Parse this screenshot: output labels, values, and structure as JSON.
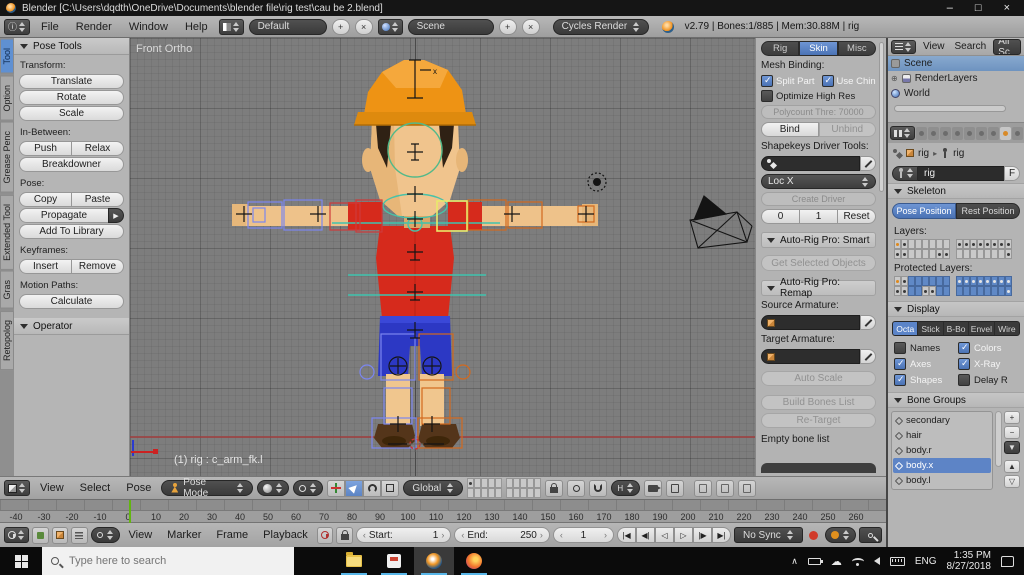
{
  "title_bar": {
    "title": "Blender [C:\\Users\\dqdth\\OneDrive\\Documents\\blender file\\rig test\\cau be 2.blend]"
  },
  "icons": {
    "minimize": "–",
    "maximize": "□",
    "close": "×",
    "add": "+",
    "x_small": "×",
    "propagate_arrow": "▶",
    "expand": "⊕",
    "playback": {
      "jump_start": "|◀",
      "prev_key": "◀|",
      "play_rev": "◁",
      "play": "▷",
      "next_key": "|▶",
      "jump_end": "▶|"
    }
  },
  "info_bar": {
    "menu_file": "File",
    "menu_render": "Render",
    "menu_window": "Window",
    "menu_help": "Help",
    "layout": "Default",
    "scene": "Scene",
    "engine": "Cycles Render",
    "stats": "v2.79 | Bones:1/885 | Mem:30.88M | rig"
  },
  "tool_shelf": {
    "tabs": [
      {
        "label": "Tool"
      },
      {
        "label": "Option"
      },
      {
        "label": "Grease Penc"
      },
      {
        "label": "Extended Tool"
      },
      {
        "label": "Gras"
      },
      {
        "label": "Retopolog"
      }
    ],
    "pose_tools_title": "Pose Tools",
    "transform_label": "Transform:",
    "translate": "Translate",
    "rotate": "Rotate",
    "scale": "Scale",
    "in_between_label": "In-Between:",
    "push": "Push",
    "relax": "Relax",
    "breakdowner": "Breakdowner",
    "pose_label": "Pose:",
    "copy": "Copy",
    "paste": "Paste",
    "propagate": "Propagate",
    "add_to_library": "Add To Library",
    "keyframes_label": "Keyframes:",
    "insert": "Insert",
    "remove": "Remove",
    "motion_paths_label": "Motion Paths:",
    "calculate": "Calculate",
    "operator_title": "Operator"
  },
  "viewport": {
    "view_label": "Front Ortho",
    "active_bone": "(1) rig : c_arm_fk.l"
  },
  "npanel": {
    "tab_rig": "Rig",
    "tab_skin": "Skin",
    "tab_misc": "Misc",
    "mesh_binding_label": "Mesh Binding:",
    "split_part": "Split Part",
    "use_chin": "Use Chin",
    "optimize_high_res": "Optimize High Res",
    "polycount": "Polycount Thre: 70000",
    "bind": "Bind",
    "unbind": "Unbind",
    "shapekeys_label": "Shapekeys Driver Tools:",
    "driver_channel": "Loc X",
    "create_driver": "Create Driver",
    "val_zero": "0",
    "val_one": "1",
    "reset": "Reset",
    "smart_title": "Auto-Rig Pro: Smart",
    "get_selected_objects": "Get Selected Objects",
    "remap_title": "Auto-Rig Pro: Remap",
    "source_armature_label": "Source Armature:",
    "target_armature_label": "Target Armature:",
    "auto_scale": "Auto Scale",
    "build_bones_list": "Build Bones List",
    "re_target": "Re-Target",
    "empty_bone_list": "Empty bone list"
  },
  "outliner": {
    "menu_view": "View",
    "menu_search": "Search",
    "scenes_filter": "All Sc",
    "item_scene": "Scene",
    "item_renderlayers": "RenderLayers",
    "item_world": "World"
  },
  "properties": {
    "breadcrumb_object": "rig",
    "breadcrumb_data": "rig",
    "id_name": "rig",
    "fake_user": "F",
    "skeleton_title": "Skeleton",
    "pose_position": "Pose Position",
    "rest_position": "Rest Position",
    "layers_label": "Layers:",
    "protected_layers_label": "Protected Layers:",
    "layers_grid_a": [
      "Od......",
      "dd....dd"
    ],
    "layers_grid_b": [
      "dddddddd",
      ".......d"
    ],
    "protected_grid_a": [
      "Odbbbbbb",
      "ddbbddbb"
    ],
    "protected_grid_b": [
      "BBBBBBBB",
      "bbbbbbbB"
    ],
    "display_title": "Display",
    "mode_octa": "Octa",
    "mode_stick": "Stick",
    "mode_bbone": "B-Bo",
    "mode_envelope": "Envel",
    "mode_wire": "Wire",
    "opt_names": "Names",
    "opt_colors": "Colors",
    "opt_axes": "Axes",
    "opt_xray": "X-Ray",
    "opt_shapes": "Shapes",
    "opt_delay": "Delay R",
    "bone_groups_title": "Bone Groups",
    "bone_groups": [
      {
        "label": "secondary"
      },
      {
        "label": "hair"
      },
      {
        "label": "body.r"
      },
      {
        "label": "body.x",
        "selected": true
      },
      {
        "label": "body.l"
      }
    ]
  },
  "view3d_header": {
    "menu_view": "View",
    "menu_select": "Select",
    "menu_pose": "Pose",
    "mode": "Pose Mode",
    "orientation": "Global",
    "layers_grid_a": [
      "d....",
      "....."
    ],
    "layers_grid_b": [
      ".....",
      "....."
    ]
  },
  "timeline": {
    "ticks": [
      "-40",
      "-30",
      "-20",
      "-10",
      "0",
      "10",
      "20",
      "30",
      "40",
      "50",
      "60",
      "70",
      "80",
      "90",
      "100",
      "110",
      "120",
      "130",
      "140",
      "150",
      "160",
      "170",
      "180",
      "190",
      "200",
      "210",
      "220",
      "230",
      "240",
      "250",
      "260"
    ],
    "menu_view": "View",
    "menu_marker": "Marker",
    "menu_frame": "Frame",
    "menu_playback": "Playback",
    "start_label": "Start:",
    "start_value": "1",
    "end_label": "End:",
    "end_value": "250",
    "current_frame": "1",
    "sync": "No Sync"
  },
  "taskbar": {
    "search_placeholder": "Type here to search",
    "language": "ENG",
    "time": "1:35 PM",
    "date": "8/27/2018"
  }
}
